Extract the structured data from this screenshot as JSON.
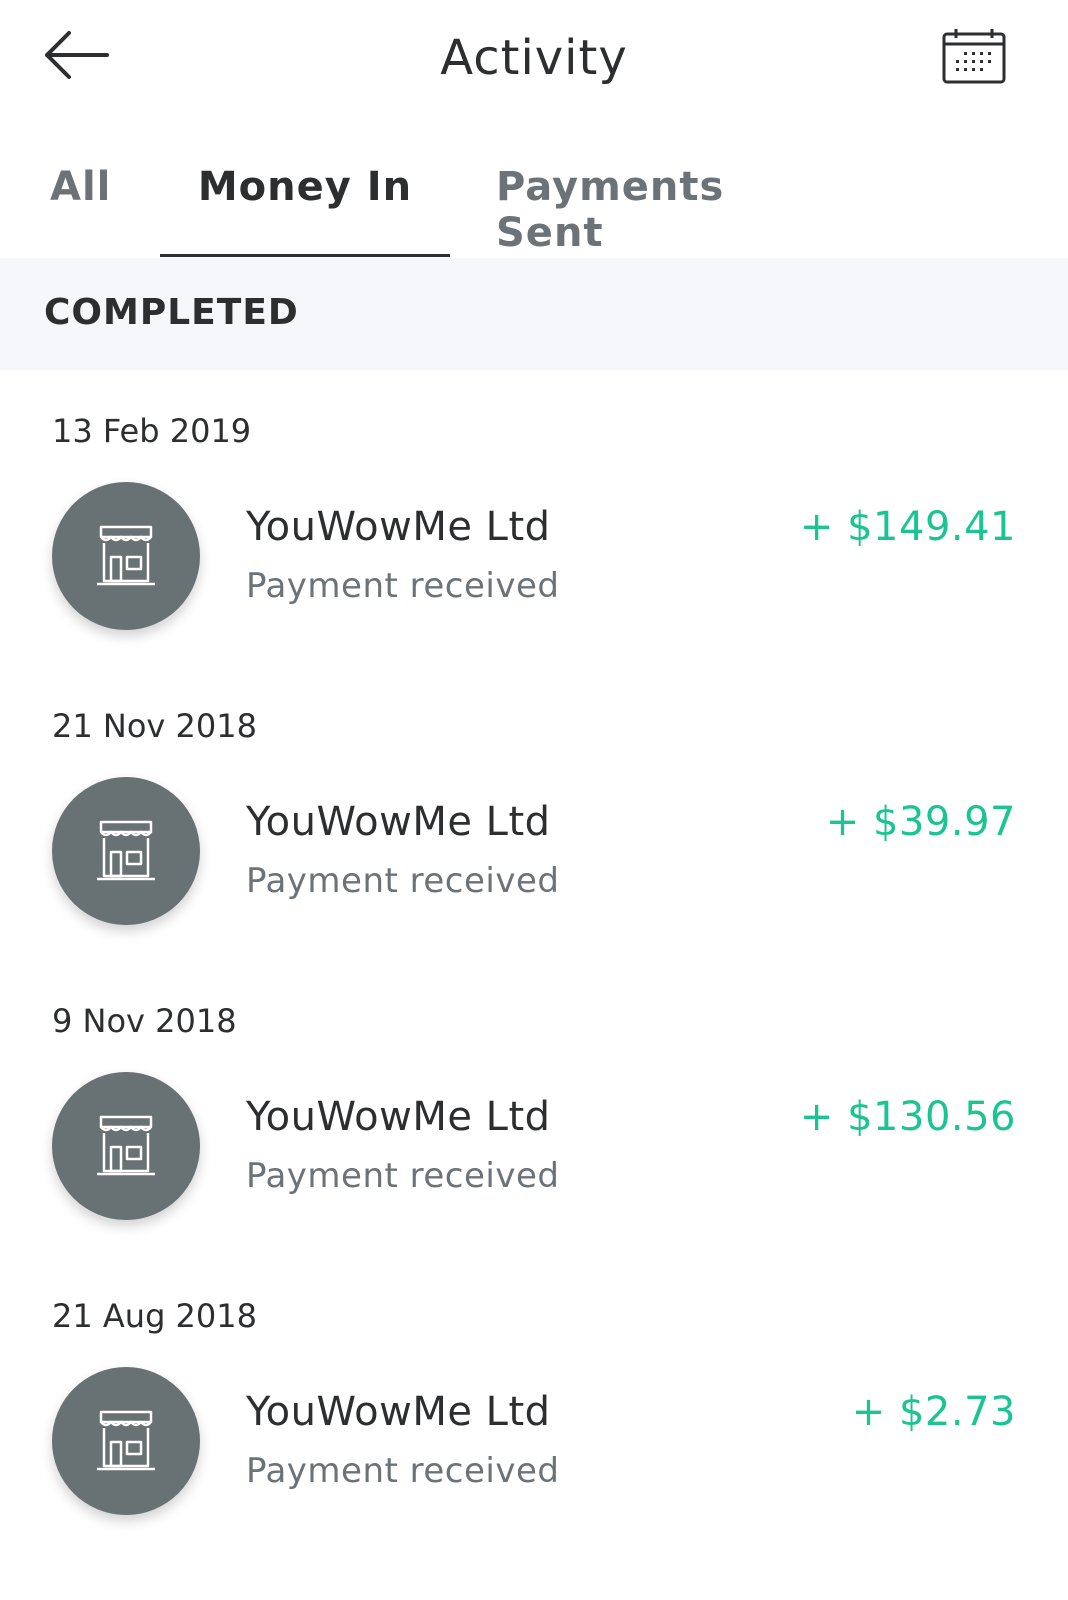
{
  "header": {
    "title": "Activity",
    "back_icon": "arrow-left-icon",
    "calendar_icon": "calendar-icon"
  },
  "tabs": [
    {
      "label": "All",
      "active": false
    },
    {
      "label": "Money In",
      "active": true
    },
    {
      "label": "Payments Sent",
      "active": false
    }
  ],
  "section": {
    "title": "COMPLETED"
  },
  "colors": {
    "positive_amount": "#1bc492",
    "avatar_bg": "#687173",
    "section_bg": "#f5f7fa"
  },
  "transactions": [
    {
      "date": "13 Feb 2019",
      "name": "YouWowMe Ltd",
      "status": "Payment received",
      "amount": "+ $149.41",
      "icon": "storefront-icon"
    },
    {
      "date": "21 Nov 2018",
      "name": "YouWowMe Ltd",
      "status": "Payment received",
      "amount": "+ $39.97",
      "icon": "storefront-icon"
    },
    {
      "date": "9 Nov 2018",
      "name": "YouWowMe Ltd",
      "status": "Payment received",
      "amount": "+ $130.56",
      "icon": "storefront-icon"
    },
    {
      "date": "21 Aug 2018",
      "name": "YouWowMe Ltd",
      "status": "Payment received",
      "amount": "+ $2.73",
      "icon": "storefront-icon"
    }
  ]
}
